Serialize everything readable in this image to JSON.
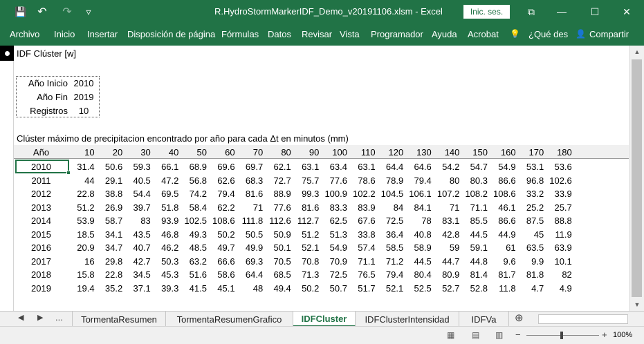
{
  "titlebar": {
    "title": "R.HydroStormMarkerIDF_Demo_v20191106.xlsm  -  Excel",
    "signin": "Inic. ses.",
    "qat": {
      "save": "💾",
      "undo": "↶",
      "redo": "↷",
      "customize": "▿"
    },
    "window": {
      "ribbon_opts": "⧉",
      "minimize": "—",
      "maximize": "☐",
      "close": "✕"
    }
  },
  "ribbon": {
    "tabs": [
      "Archivo",
      "Inicio",
      "Insertar",
      "Disposición de página",
      "Fórmulas",
      "Datos",
      "Revisar",
      "Vista",
      "Programador",
      "Ayuda",
      "Acrobat"
    ],
    "tell_me": "¿Qué des",
    "share": "Compartir",
    "lightbulb": "💡",
    "person": "👤"
  },
  "sheet": {
    "heading": "IDF Clúster [w]",
    "info": {
      "rows": [
        {
          "label": "Año Inicio",
          "value": "2010"
        },
        {
          "label": "Año Fin",
          "value": "2019"
        },
        {
          "label": "Registros",
          "value": "10"
        }
      ]
    },
    "table_caption": "Clúster máximo de precipitacion encontrado por año para cada Δt en minutos (mm)",
    "col_header_first": "Año",
    "durations": [
      "10",
      "20",
      "30",
      "40",
      "50",
      "60",
      "70",
      "80",
      "90",
      "100",
      "110",
      "120",
      "130",
      "140",
      "150",
      "160",
      "170",
      "180"
    ],
    "rows": [
      {
        "year": "2010",
        "values": [
          "31.4",
          "50.6",
          "59.3",
          "66.1",
          "68.9",
          "69.6",
          "69.7",
          "62.1",
          "63.1",
          "63.4",
          "63.1",
          "64.4",
          "64.6",
          "54.2",
          "54.7",
          "54.9",
          "53.1",
          "53.6"
        ]
      },
      {
        "year": "2011",
        "values": [
          "44",
          "29.1",
          "40.5",
          "47.2",
          "56.8",
          "62.6",
          "68.3",
          "72.7",
          "75.7",
          "77.6",
          "78.6",
          "78.9",
          "79.4",
          "80",
          "80.3",
          "86.6",
          "96.8",
          "102.6"
        ]
      },
      {
        "year": "2012",
        "values": [
          "22.8",
          "38.8",
          "54.4",
          "69.5",
          "74.2",
          "79.4",
          "81.6",
          "88.9",
          "99.3",
          "100.9",
          "102.2",
          "104.5",
          "106.1",
          "107.2",
          "108.2",
          "108.6",
          "33.2",
          "33.9"
        ]
      },
      {
        "year": "2013",
        "values": [
          "51.2",
          "26.9",
          "39.7",
          "51.8",
          "58.4",
          "62.2",
          "71",
          "77.6",
          "81.6",
          "83.3",
          "83.9",
          "84",
          "84.1",
          "71",
          "71.1",
          "46.1",
          "25.2",
          "25.7"
        ]
      },
      {
        "year": "2014",
        "values": [
          "53.9",
          "58.7",
          "83",
          "93.9",
          "102.5",
          "108.6",
          "111.8",
          "112.6",
          "112.7",
          "62.5",
          "67.6",
          "72.5",
          "78",
          "83.1",
          "85.5",
          "86.6",
          "87.5",
          "88.8"
        ]
      },
      {
        "year": "2015",
        "values": [
          "18.5",
          "34.1",
          "43.5",
          "46.8",
          "49.3",
          "50.2",
          "50.5",
          "50.9",
          "51.2",
          "51.3",
          "33.8",
          "36.4",
          "40.8",
          "42.8",
          "44.5",
          "44.9",
          "45",
          "11.9"
        ]
      },
      {
        "year": "2016",
        "values": [
          "20.9",
          "34.7",
          "40.7",
          "46.2",
          "48.5",
          "49.7",
          "49.9",
          "50.1",
          "52.1",
          "54.9",
          "57.4",
          "58.5",
          "58.9",
          "59",
          "59.1",
          "61",
          "63.5",
          "63.9"
        ]
      },
      {
        "year": "2017",
        "values": [
          "16",
          "29.8",
          "42.7",
          "50.3",
          "63.2",
          "66.6",
          "69.3",
          "70.5",
          "70.8",
          "70.9",
          "71.1",
          "71.2",
          "44.5",
          "44.7",
          "44.8",
          "9.6",
          "9.9",
          "10.1"
        ]
      },
      {
        "year": "2018",
        "values": [
          "15.8",
          "22.8",
          "34.5",
          "45.3",
          "51.6",
          "58.6",
          "64.4",
          "68.5",
          "71.3",
          "72.5",
          "76.5",
          "79.4",
          "80.4",
          "80.9",
          "81.4",
          "81.7",
          "81.8",
          "82"
        ]
      },
      {
        "year": "2019",
        "values": [
          "19.4",
          "35.2",
          "37.1",
          "39.3",
          "41.5",
          "45.1",
          "48",
          "49.4",
          "50.2",
          "50.7",
          "51.7",
          "52.1",
          "52.5",
          "52.7",
          "52.8",
          "11.8",
          "4.7",
          "4.9"
        ]
      }
    ]
  },
  "sheet_tabs": {
    "nav_prev": "◀",
    "nav_next": "▶",
    "ellipsis": "...",
    "tabs": [
      "TormentaResumen",
      "TormentaResumenGrafico",
      "IDFCluster",
      "IDFClusterIntensidad",
      "IDFVa"
    ],
    "active": "IDFCluster",
    "add": "⊕"
  },
  "statusbar": {
    "zoom_minus": "−",
    "zoom_plus": "+",
    "zoom": "100%"
  }
}
